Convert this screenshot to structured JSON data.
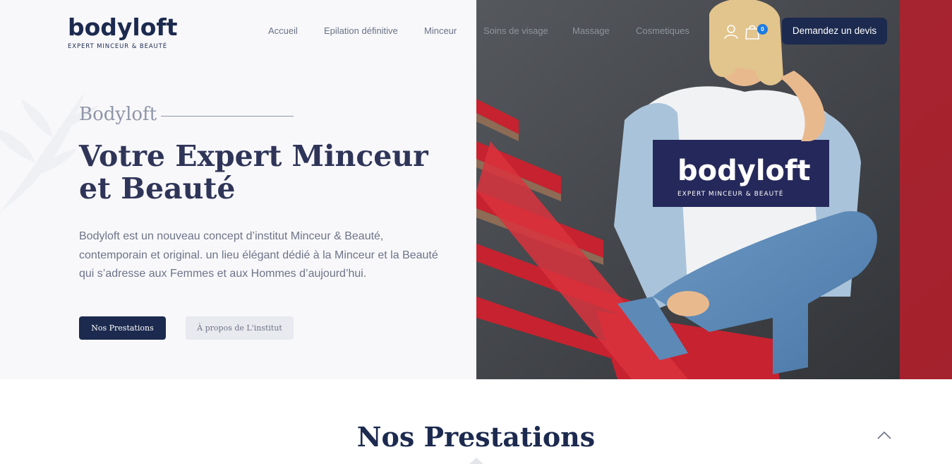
{
  "header": {
    "logo": {
      "name": "bodyloft",
      "tagline": "EXPERT MINCEUR & BEAUTÉ"
    },
    "nav": [
      {
        "label": "Accueil"
      },
      {
        "label": "Epilation définitive"
      },
      {
        "label": "Minceur"
      },
      {
        "label": "Soins de visage"
      },
      {
        "label": "Massage"
      },
      {
        "label": "Cosmetiques"
      }
    ],
    "icons": {
      "account": "user-icon",
      "cart": "shopping-bag-icon"
    },
    "cart_count": "0",
    "cta_label": "Demandez un devis"
  },
  "hero": {
    "kicker": "Bodyloft",
    "headline": "Votre Expert Minceur et Beauté",
    "lead": "Bodyloft est un nouveau concept d’institut Minceur & Beauté, contemporain et original. un lieu élégant dédié à la Minceur et la Beauté qui s’adresse aux Femmes et aux Hommes d’aujourd’hui.",
    "primary_button": "Nos Prestations",
    "secondary_button": "À propos de L'institut",
    "photo": {
      "shirt_text": "bodyloft",
      "shirt_tagline": "EXPERT MINCEUR & BEAUTÉ"
    }
  },
  "section": {
    "title": "Nos Prestations",
    "scroll_icon": "chevron-up-icon"
  },
  "colors": {
    "brand_navy": "#1c2a4f",
    "hero_bg": "#f8f8fa",
    "badge_blue": "#1e7be0",
    "secondary_button_bg": "#e9eaef"
  }
}
